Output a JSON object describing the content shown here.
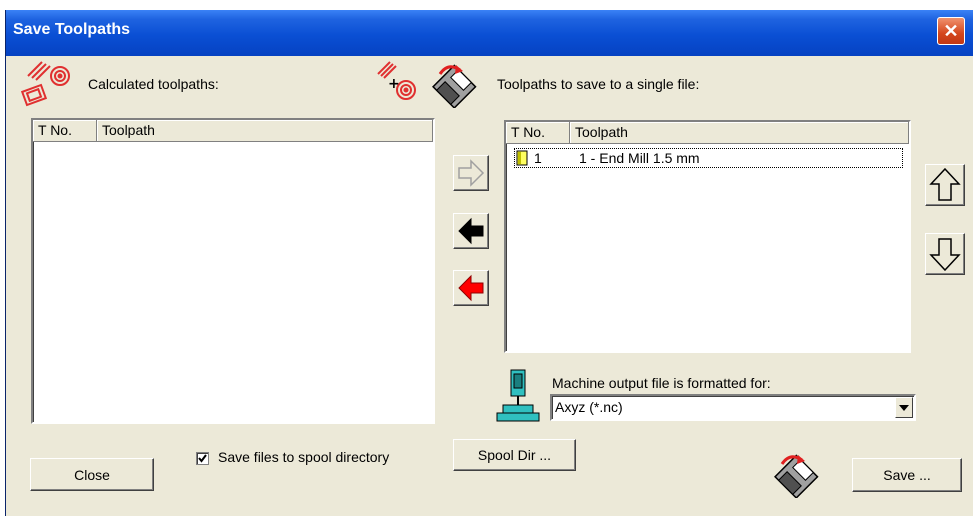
{
  "window": {
    "title": "Save Toolpaths",
    "close_glyph": "✕"
  },
  "calculated": {
    "label": "Calculated toolpaths:",
    "columns": [
      "T No.",
      "Toolpath"
    ],
    "rows": []
  },
  "tosave": {
    "label": "Toolpaths to save to a single file:",
    "columns": [
      "T No.",
      "Toolpath"
    ],
    "rows": [
      {
        "tno": "1",
        "toolpath": "1 - End Mill 1.5 mm"
      }
    ]
  },
  "machine": {
    "label": "Machine output file is formatted for:",
    "selected": "Axyz (*.nc)"
  },
  "spool": {
    "checkbox_label": "Save files to spool directory",
    "checked": true,
    "button_label": "Spool Dir ..."
  },
  "buttons": {
    "close": "Close",
    "save": "Save ..."
  },
  "icons": {
    "calculated": "toolpaths-icon",
    "add": "toolpath-add-icon",
    "save_disk": "floppy-save-icon",
    "machine": "machine-tool-icon",
    "arrow_right": "arrow-right-disabled-icon",
    "arrow_left": "arrow-left-icon",
    "arrow_left_all": "arrow-left-red-icon",
    "up": "arrow-up-icon",
    "down": "arrow-down-icon"
  },
  "colors": {
    "title_bar": "#0a4fd4",
    "close": "#d4461c",
    "remove_all_arrow": "#ff0000"
  }
}
